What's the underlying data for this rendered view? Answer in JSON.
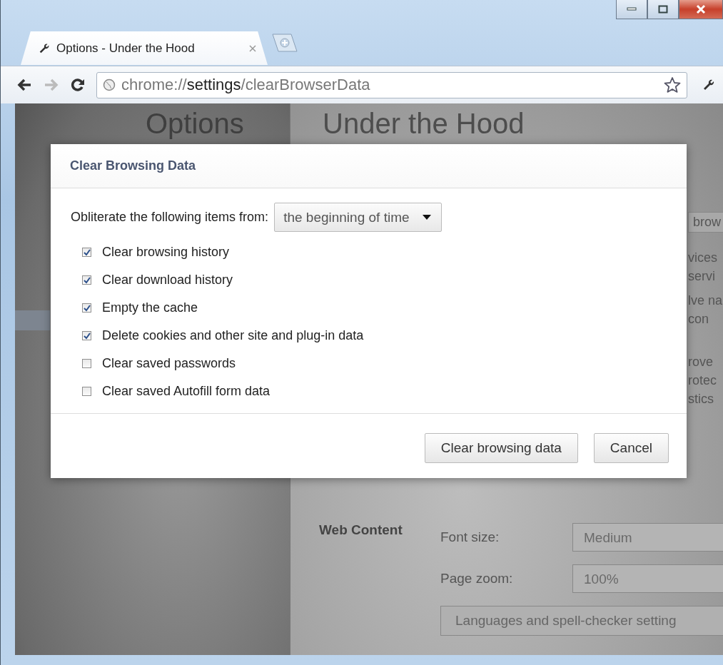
{
  "tabs": [
    {
      "title": "Options - Under the Hood",
      "selected": true
    }
  ],
  "address_bar": {
    "scheme": "chrome://",
    "host": "settings",
    "path": "/clearBrowserData"
  },
  "settings_page": {
    "sidebar_title": "Options",
    "page_title": "Under the Hood",
    "side_button": "brow",
    "right_fragments": [
      "vices",
      "servi",
      "lve na",
      "con",
      "rove",
      "rotec",
      "stics"
    ],
    "web_content": {
      "label": "Web Content",
      "fields": [
        {
          "label": "Font size:",
          "value": "Medium"
        },
        {
          "label": "Page zoom:",
          "value": "100%"
        }
      ],
      "button": "Languages and spell-checker setting"
    }
  },
  "dialog": {
    "title": "Clear Browsing Data",
    "range_label": "Obliterate the following items from:",
    "range_value": "the beginning of time",
    "items": [
      {
        "label": "Clear browsing history",
        "checked": true
      },
      {
        "label": "Clear download history",
        "checked": true
      },
      {
        "label": "Empty the cache",
        "checked": true
      },
      {
        "label": "Delete cookies and other site and plug-in data",
        "checked": true
      },
      {
        "label": "Clear saved passwords",
        "checked": false
      },
      {
        "label": "Clear saved Autofill form data",
        "checked": false
      }
    ],
    "buttons": [
      "Clear browsing data",
      "Cancel"
    ]
  }
}
